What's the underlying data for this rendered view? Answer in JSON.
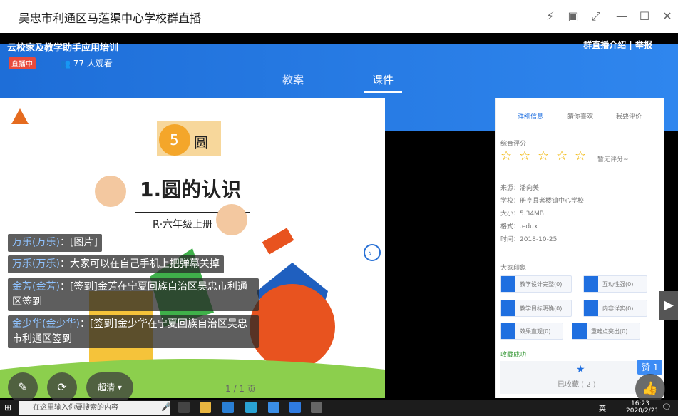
{
  "window": {
    "title": "吴忠市利通区马莲渠中心学校群直播"
  },
  "live": {
    "course_title": "云校家及教学助手应用培训",
    "badge": "直播中",
    "viewers": "77 人观看",
    "links": "群直播介绍 | 举报"
  },
  "tabs": [
    {
      "label": "教案"
    },
    {
      "label": "课件"
    }
  ],
  "slide": {
    "chapter_number": "5",
    "chapter_title": "圆",
    "lesson_title": "1.圆的认识",
    "grade": "R·六年级上册",
    "pager": "1 / 1 页"
  },
  "right_panel": {
    "tabs": [
      "详细信息",
      "猜你喜欢",
      "我要评价"
    ],
    "rating_label": "综合评分",
    "no_rating": "暂无评分~",
    "source": "来源：潘向美",
    "school": "学校：册亨县者楼镇中心学校",
    "size": "大小：5.34MB",
    "format": "格式：.edux",
    "time": "时间：2018-10-25",
    "impression_label": "大家印象",
    "impressions": [
      "教学设计完整(0)",
      "互动性强(0)",
      "教学目标明确(0)",
      "内容详实(0)",
      "效果直观(0)",
      "重难点突出(0)"
    ],
    "favorited": "收藏成功",
    "favorite_count": "已收藏 ( 2 )"
  },
  "danmu": [
    {
      "name": "万乐(万乐)",
      "text": "：[图片]"
    },
    {
      "name": "万乐(万乐)",
      "text": "：大家可以在自己手机上把弹幕关掉"
    },
    {
      "name": "金芳(金芳)",
      "text": "：[签到]金芳在宁夏回族自治区吴忠市利通区签到"
    },
    {
      "name": "金少华(金少华)",
      "text": "：[签到]金少华在宁夏回族自治区吴忠市利通区签到"
    }
  ],
  "controls": {
    "quality": "超清 ▾",
    "like_count": "赞 1"
  },
  "taskbar": {
    "search_placeholder": "在这里输入你要搜索的内容",
    "time": "16:23",
    "date": "2020/2/21",
    "ime": "英"
  }
}
